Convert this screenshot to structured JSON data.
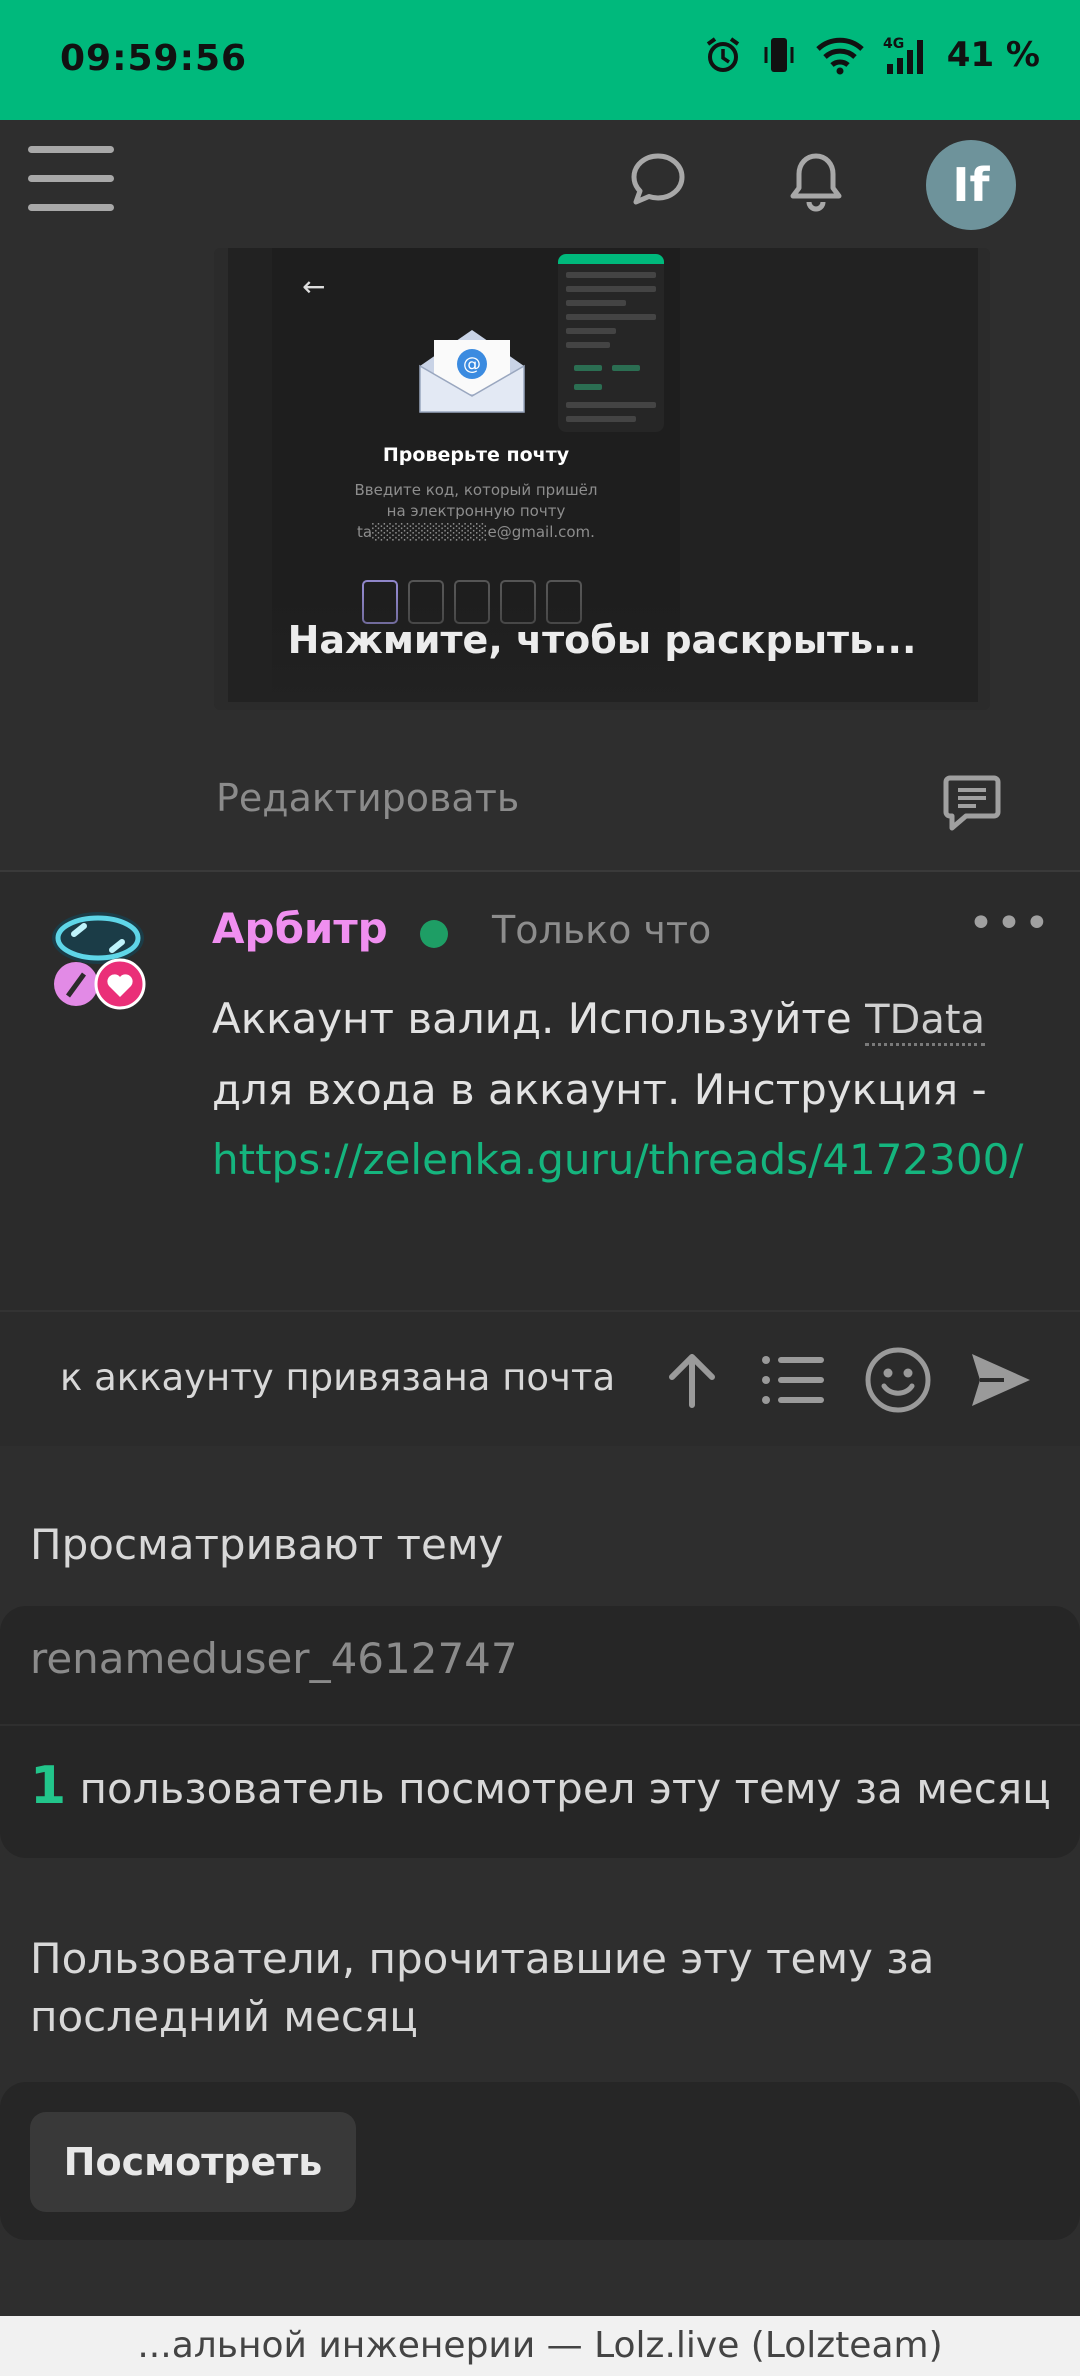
{
  "status_bar": {
    "time": "09:59:56",
    "battery": "41 %",
    "network": "4G"
  },
  "app_bar": {
    "avatar_initials": "If"
  },
  "preview": {
    "title": "Проверьте почту",
    "description_1": "Введите код, который пришёл",
    "description_2": "на электронную почту",
    "email": "ta░░░░░░░░░░e@gmail.com.",
    "expand_hint": "Нажмите, чтобы раскрыть..."
  },
  "edit": {
    "label": "Редактировать"
  },
  "post": {
    "author": "Арбитр",
    "time": "Только что",
    "more": "•••",
    "body_part1": "Аккаунт валид. Используйте ",
    "body_abbr": "TData",
    "body_part2": " для входа в аккаунт. Инструкция -",
    "link": "https://zelenka.guru/threads/4172300/"
  },
  "composer": {
    "text": "к аккаунту привязана почта"
  },
  "viewing": {
    "title": "Просматривают тему",
    "user": "renameduser_4612747",
    "count": "1",
    "count_text": "пользователь посмотрел эту тему за месяц"
  },
  "readers": {
    "title": "Пользователи, прочитавшие эту тему за последний месяц",
    "button": "Посмотреть"
  },
  "footer": {
    "page_title": "...альной инженерии — Lolz.live (Lolzteam)"
  },
  "colors": {
    "accent": "#00b97c",
    "author": "#f08ff0",
    "link": "#15b57e"
  }
}
